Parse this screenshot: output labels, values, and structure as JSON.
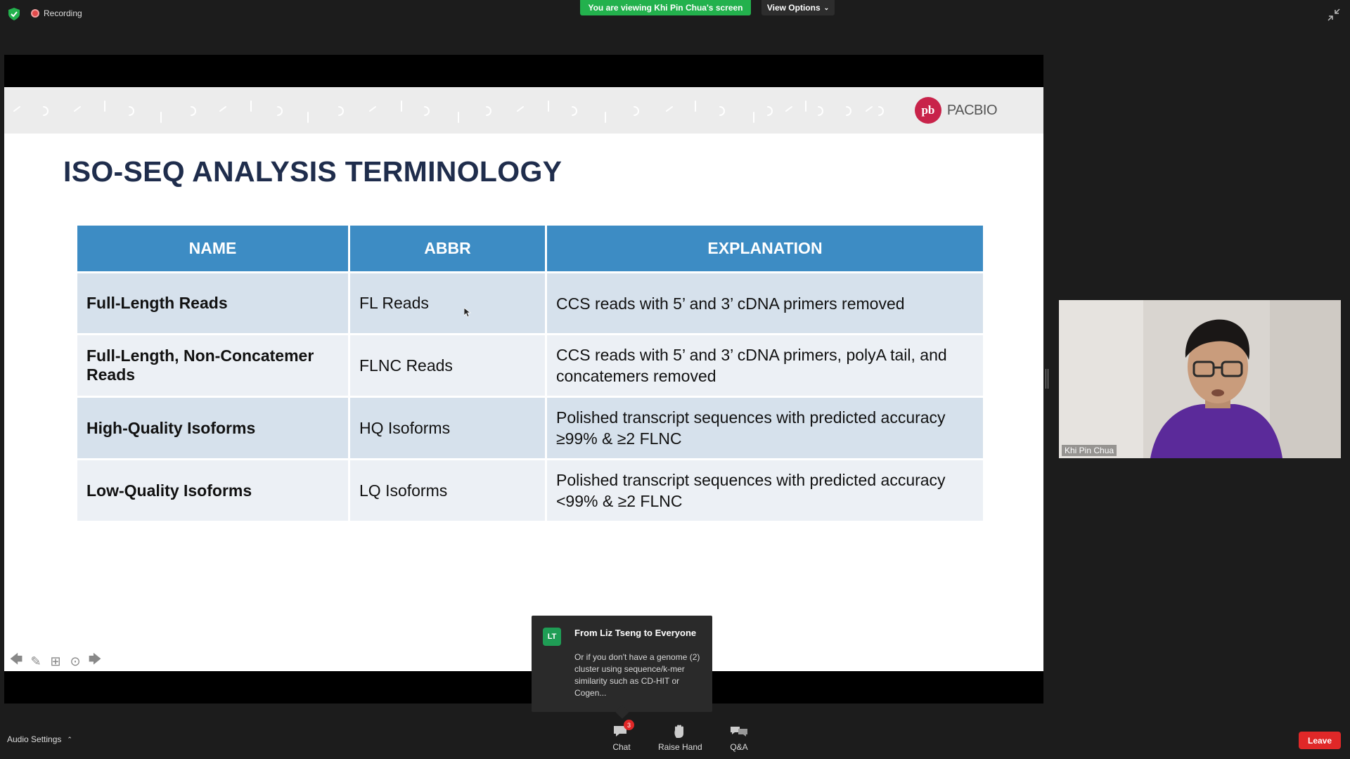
{
  "topbar": {
    "recording_label": "Recording",
    "viewing_banner": "You are viewing Khi Pin Chua's screen",
    "view_options_label": "View Options"
  },
  "slide": {
    "title": "ISO-SEQ ANALYSIS TERMINOLOGY",
    "logo_text": "PACBIO",
    "logo_mark": "pb",
    "table": {
      "headers": [
        "NAME",
        "ABBR",
        "EXPLANATION"
      ],
      "rows": [
        {
          "name": "Full-Length Reads",
          "abbr": "FL Reads",
          "explanation": "CCS reads with 5’ and 3’ cDNA primers removed"
        },
        {
          "name": "Full-Length, Non-Concatemer Reads",
          "abbr": "FLNC Reads",
          "explanation": "CCS reads with 5’ and 3’ cDNA primers, polyA tail, and concatemers removed"
        },
        {
          "name": "High-Quality Isoforms",
          "abbr": "HQ Isoforms",
          "explanation": "Polished transcript sequences with predicted accuracy ≥99% & ≥2 FLNC"
        },
        {
          "name": "Low-Quality Isoforms",
          "abbr": "LQ Isoforms",
          "explanation": "Polished transcript sequences with predicted accuracy <99% & ≥2 FLNC"
        }
      ]
    }
  },
  "video": {
    "participant_name": "Khi Pin Chua"
  },
  "chat_notification": {
    "avatar_initials": "LT",
    "from": "From Liz Tseng to Everyone",
    "message": "Or if you don't have a genome (2) cluster using sequence/k-mer similarity such as CD-HIT or Cogen..."
  },
  "bottombar": {
    "audio_settings_label": "Audio Settings",
    "chat_label": "Chat",
    "chat_badge": "3",
    "raise_hand_label": "Raise Hand",
    "qa_label": "Q&A",
    "leave_label": "Leave"
  },
  "colors": {
    "viewing_banner": "#23b14d",
    "table_header": "#3d8cc4",
    "title": "#1f2d4c",
    "leave": "#e02828",
    "logo": "#c8234a"
  }
}
